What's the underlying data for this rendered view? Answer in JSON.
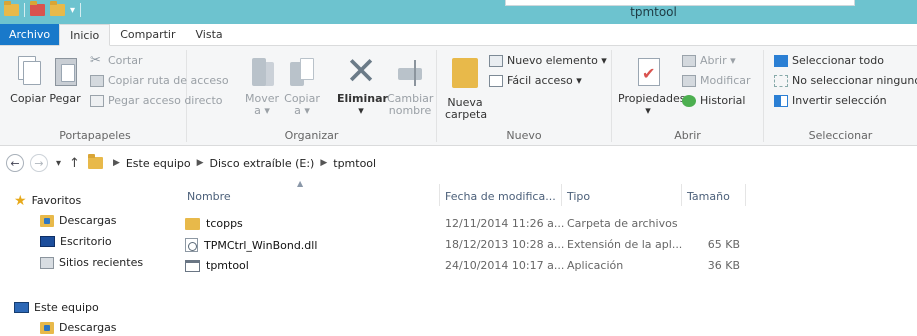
{
  "window": {
    "title": "tpmtool"
  },
  "tabs": [
    {
      "label": "Archivo"
    },
    {
      "label": "Inicio"
    },
    {
      "label": "Compartir"
    },
    {
      "label": "Vista"
    }
  ],
  "ribbon": {
    "portapapeles": {
      "label": "Portapapeles",
      "copiar": "Copiar",
      "pegar": "Pegar",
      "cortar": "Cortar",
      "copiar_ruta": "Copiar ruta de acceso",
      "pegar_acceso": "Pegar acceso directo"
    },
    "organizar": {
      "label": "Organizar",
      "mover_1": "Mover",
      "mover_2": "a ▾",
      "copiar_1": "Copiar",
      "copiar_2": "a ▾",
      "eliminar_1": "Eliminar",
      "eliminar_2": "▾",
      "cambiar_1": "Cambiar",
      "cambiar_2": "nombre"
    },
    "nuevo": {
      "label": "Nuevo",
      "nueva_1": "Nueva",
      "nueva_2": "carpeta",
      "nuevo_elemento": "Nuevo elemento ▾",
      "facil_acceso": "Fácil acceso ▾"
    },
    "abrir": {
      "label": "Abrir",
      "propiedades_1": "Propiedades",
      "propiedades_2": "▾",
      "abrir": "Abrir ▾",
      "modificar": "Modificar",
      "historial": "Historial"
    },
    "seleccionar": {
      "label": "Seleccionar",
      "todo": "Seleccionar todo",
      "ninguno": "No seleccionar ninguno",
      "invertir": "Invertir selección"
    }
  },
  "address": {
    "back": "←",
    "forward": "→",
    "recent": "▾",
    "up": "↑",
    "crumbs": [
      "Este equipo",
      "Disco extraíble (E:)",
      "tpmtool"
    ]
  },
  "nav": {
    "favoritos": "Favoritos",
    "descargas": "Descargas",
    "escritorio": "Escritorio",
    "sitios": "Sitios recientes",
    "equipo": "Este equipo",
    "descargas2": "Descargas"
  },
  "columns": {
    "name": "Nombre",
    "date": "Fecha de modifica...",
    "type": "Tipo",
    "size": "Tamaño"
  },
  "files": [
    {
      "name": "tcopps",
      "date": "12/11/2014 11:26 a...",
      "type": "Carpeta de archivos",
      "size": "",
      "icon": "folder-icon"
    },
    {
      "name": "TPMCtrl_WinBond.dll",
      "date": "18/12/2013 10:28 a...",
      "type": "Extensión de la apl...",
      "size": "65 KB",
      "icon": "dll-file-icon"
    },
    {
      "name": "tpmtool",
      "date": "24/10/2014 10:17 a...",
      "type": "Aplicación",
      "size": "36 KB",
      "icon": "application-icon"
    }
  ]
}
